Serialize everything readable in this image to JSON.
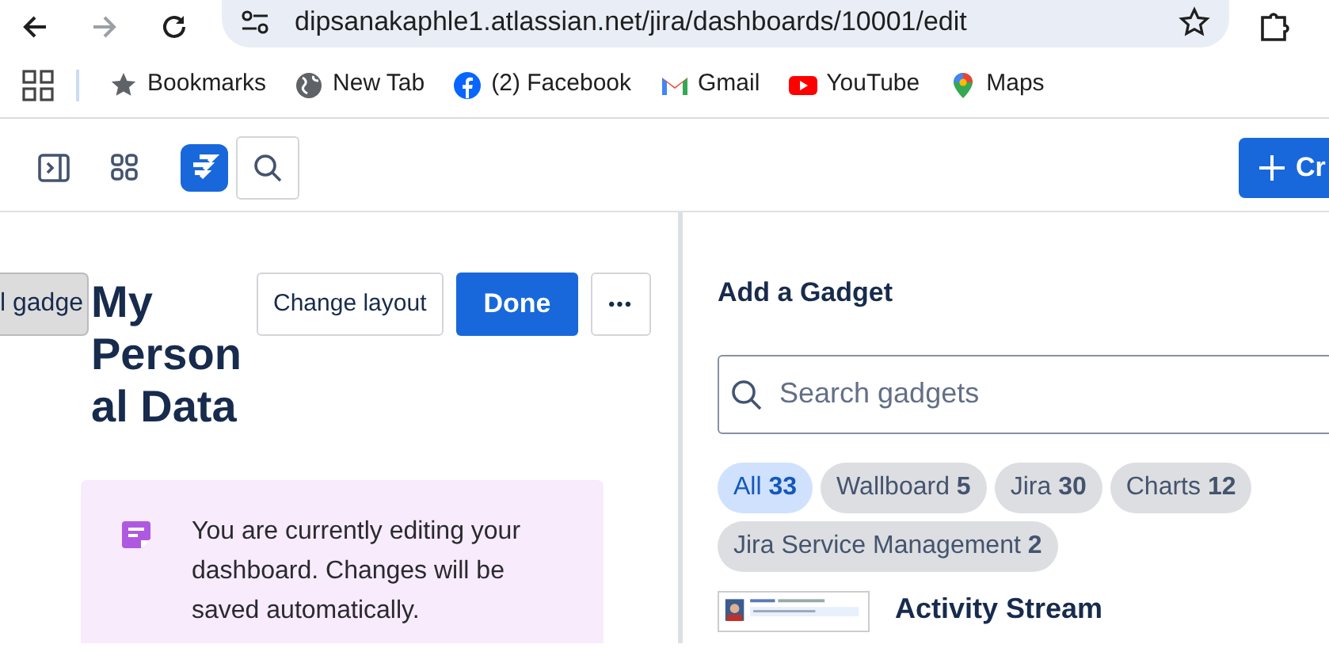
{
  "browser": {
    "url": "dipsanakaphle1.atlassian.net/jira/dashboards/10001/edit",
    "bookmarks": [
      {
        "label": "Bookmarks",
        "kind": "star"
      },
      {
        "label": "New Tab",
        "kind": "globe"
      },
      {
        "label": "(2) Facebook",
        "kind": "facebook"
      },
      {
        "label": "Gmail",
        "kind": "gmail"
      },
      {
        "label": "YouTube",
        "kind": "youtube"
      },
      {
        "label": "Maps",
        "kind": "maps"
      }
    ]
  },
  "app_header": {
    "create_button": "Cr"
  },
  "dashboard": {
    "add_gadget_button": "l gadge",
    "title": "My Personal Data",
    "change_layout_button": "Change layout",
    "done_button": "Done",
    "more_button": "•••",
    "notice": "You are currently editing your dashboard. Changes will be saved automatically."
  },
  "gadget_panel": {
    "title": "Add a Gadget",
    "search": {
      "placeholder": "Search gadgets"
    },
    "filters": [
      {
        "label": "All",
        "count": "33",
        "selected": true
      },
      {
        "label": "Wallboard",
        "count": "5",
        "selected": false
      },
      {
        "label": "Jira",
        "count": "30",
        "selected": false
      },
      {
        "label": "Charts",
        "count": "12",
        "selected": false
      },
      {
        "label": "Jira Service Management",
        "count": "2",
        "selected": false
      }
    ],
    "gadgets": [
      {
        "name": "Activity Stream"
      }
    ]
  }
}
